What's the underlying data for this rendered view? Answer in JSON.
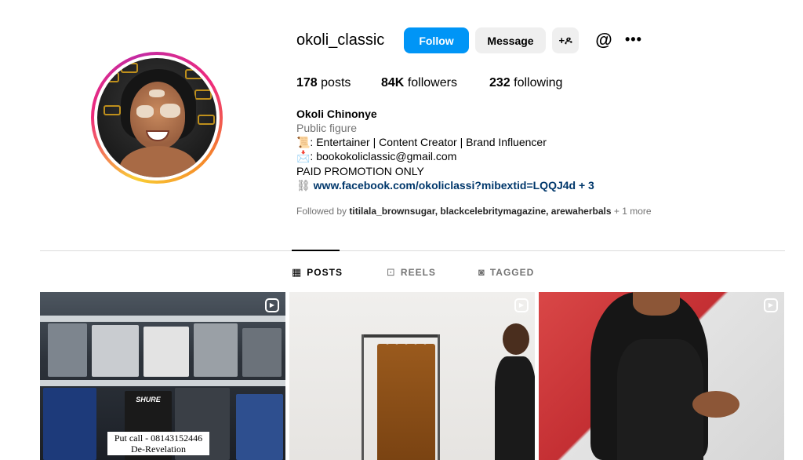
{
  "profile": {
    "username": "okoli_classic",
    "buttons": {
      "follow": "Follow",
      "message": "Message",
      "add_user": "+ዶ"
    },
    "stats": {
      "posts_count": "178",
      "posts_label": "posts",
      "followers_count": "84K",
      "followers_label": "followers",
      "following_count": "232",
      "following_label": "following"
    },
    "bio": {
      "name": "Okoli Chinonye",
      "category": "Public figure",
      "line1": "📜: Entertainer | Content Creator | Brand Influencer",
      "line2": "📩: bookokoliclassic@gmail.com",
      "line3": "PAID PROMOTION ONLY",
      "link": "www.facebook.com/okoliclassi?mibextid=LQQJ4d + 3"
    },
    "followed_by": {
      "prefix": "Followed by",
      "names": "titilala_brownsugar, blackcelebritymagazine, arewaherbals",
      "suffix": "+ 1 more"
    }
  },
  "tabs": [
    {
      "label": "POSTS",
      "icon": "grid-icon",
      "active": true
    },
    {
      "label": "REELS",
      "icon": "reels-icon",
      "active": false
    },
    {
      "label": "TAGGED",
      "icon": "tagged-icon",
      "active": false
    }
  ],
  "posts": [
    {
      "caption_line1": "Put call - 08143152446",
      "caption_line2": "De-Revelation",
      "brand": "SHURE",
      "type": "reel"
    },
    {
      "type": "reel"
    },
    {
      "type": "reel"
    }
  ],
  "colors": {
    "accent": "#0095f6",
    "link": "#00376b",
    "muted": "#737373"
  }
}
